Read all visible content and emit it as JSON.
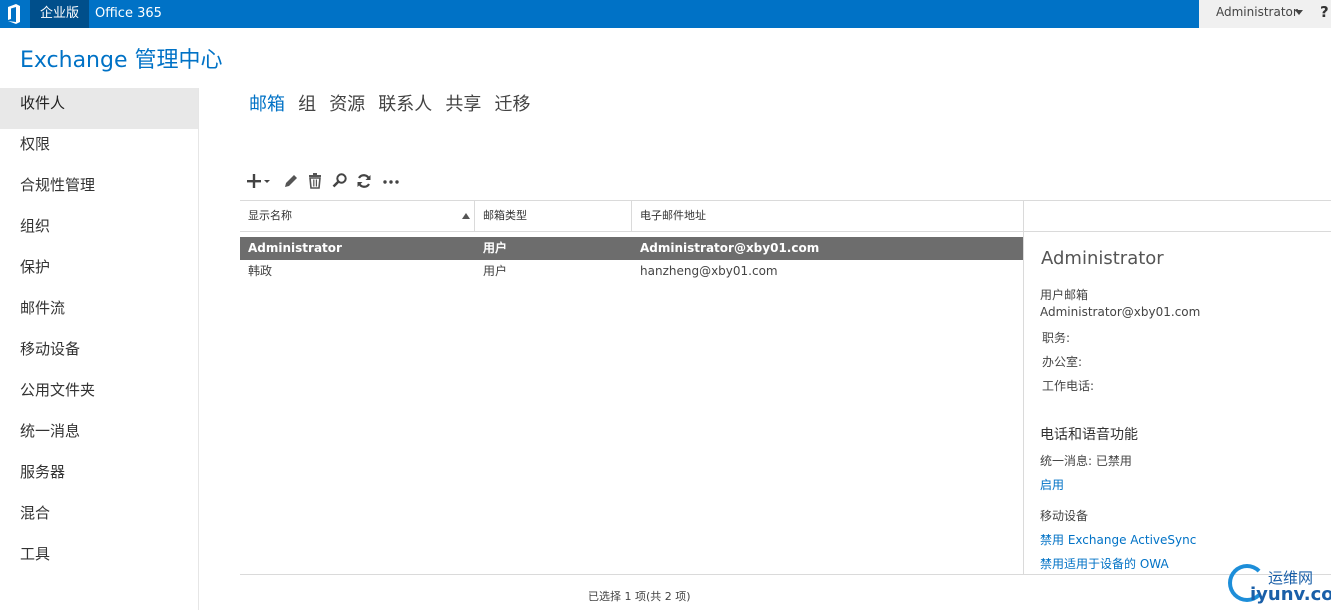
{
  "topbar": {
    "brand": "企业版",
    "o365": "Office 365",
    "user": "Administrator",
    "help": "?"
  },
  "app_title": "Exchange 管理中心",
  "sidebar": {
    "items": [
      {
        "label": "收件人"
      },
      {
        "label": "权限"
      },
      {
        "label": "合规性管理"
      },
      {
        "label": "组织"
      },
      {
        "label": "保护"
      },
      {
        "label": "邮件流"
      },
      {
        "label": "移动设备"
      },
      {
        "label": "公用文件夹"
      },
      {
        "label": "统一消息"
      },
      {
        "label": "服务器"
      },
      {
        "label": "混合"
      },
      {
        "label": "工具"
      }
    ],
    "active_index": 0
  },
  "tabs": [
    {
      "label": "邮箱"
    },
    {
      "label": "组"
    },
    {
      "label": "资源"
    },
    {
      "label": "联系人"
    },
    {
      "label": "共享"
    },
    {
      "label": "迁移"
    }
  ],
  "toolbar": {
    "icons": [
      "add-icon",
      "edit-icon",
      "delete-icon",
      "search-icon",
      "refresh-icon",
      "more-icon"
    ]
  },
  "grid": {
    "columns": [
      "显示名称",
      "邮箱类型",
      "电子邮件地址"
    ],
    "rows": [
      {
        "name": "Administrator",
        "type": "用户",
        "email": "Administrator@xby01.com",
        "selected": true
      },
      {
        "name": "韩政",
        "type": "用户",
        "email": "hanzheng@xby01.com",
        "selected": false
      }
    ],
    "status": "已选择 1 项(共 2 项)"
  },
  "details": {
    "name": "Administrator",
    "mailbox_type_label": "用户邮箱",
    "email": "Administrator@xby01.com",
    "title_label": "职务:",
    "office_label": "办公室:",
    "phone_label": "工作电话:",
    "section_phone_voice": "电话和语音功能",
    "um_status": "统一消息: 已禁用",
    "enable_link": "启用",
    "mobile_label": "移动设备",
    "disable_activesync": "禁用 Exchange ActiveSync",
    "disable_owa": "禁用适用于设备的 OWA"
  },
  "watermark": {
    "cn": "运维网",
    "en": "iyunv.com"
  },
  "colors": {
    "accent": "#0072c6",
    "selected_row": "#6d6d6d"
  }
}
